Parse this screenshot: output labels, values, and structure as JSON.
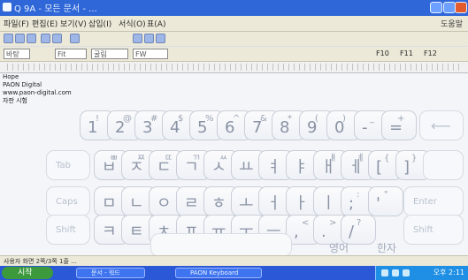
{
  "window": {
    "title": "Q 9A - 모든 문서 - ..."
  },
  "menubar": {
    "items": [
      "파일(F)",
      "편집(E)",
      "보기(V)",
      "삽입(I)",
      "서식(O)",
      "표(A)"
    ],
    "help": "도움말"
  },
  "formatbar": {
    "style_combo": "바탕",
    "size_combo": "Fit",
    "font_combo": "굴림",
    "zoom_combo": "FW",
    "function_keys": [
      "F10",
      "F11",
      "F12"
    ]
  },
  "document": {
    "lines": [
      "Hope",
      "PAON Digital",
      "www.paon-digital.com",
      "자판 시험"
    ]
  },
  "keyboard": {
    "row1": [
      {
        "primary": "1",
        "secondary": "!"
      },
      {
        "primary": "2",
        "secondary": "@"
      },
      {
        "primary": "3",
        "secondary": "#"
      },
      {
        "primary": "4",
        "secondary": "$"
      },
      {
        "primary": "5",
        "secondary": "%"
      },
      {
        "primary": "6",
        "secondary": "^"
      },
      {
        "primary": "7",
        "secondary": "&"
      },
      {
        "primary": "8",
        "secondary": "*"
      },
      {
        "primary": "9",
        "secondary": "("
      },
      {
        "primary": "0",
        "secondary": ")"
      },
      {
        "primary": "-",
        "secondary": "_"
      },
      {
        "primary": "=",
        "secondary": "+"
      }
    ],
    "row2": [
      {
        "primary": "ㅂ",
        "secondary": "ㅃ"
      },
      {
        "primary": "ㅈ",
        "secondary": "ㅉ"
      },
      {
        "primary": "ㄷ",
        "secondary": "ㄸ"
      },
      {
        "primary": "ㄱ",
        "secondary": "ㄲ"
      },
      {
        "primary": "ㅅ",
        "secondary": "ㅆ"
      },
      {
        "primary": "ㅛ",
        "secondary": ""
      },
      {
        "primary": "ㅕ",
        "secondary": ""
      },
      {
        "primary": "ㅑ",
        "secondary": ""
      },
      {
        "primary": "ㅐ",
        "secondary": "ㅒ"
      },
      {
        "primary": "ㅔ",
        "secondary": "ㅖ"
      },
      {
        "primary": "[",
        "secondary": "{"
      },
      {
        "primary": "]",
        "secondary": "}"
      }
    ],
    "row3": [
      {
        "primary": "ㅁ",
        "secondary": ""
      },
      {
        "primary": "ㄴ",
        "secondary": ""
      },
      {
        "primary": "ㅇ",
        "secondary": ""
      },
      {
        "primary": "ㄹ",
        "secondary": ""
      },
      {
        "primary": "ㅎ",
        "secondary": ""
      },
      {
        "primary": "ㅗ",
        "secondary": ""
      },
      {
        "primary": "ㅓ",
        "secondary": ""
      },
      {
        "primary": "ㅏ",
        "secondary": ""
      },
      {
        "primary": "ㅣ",
        "secondary": ""
      },
      {
        "primary": ";",
        "secondary": ":"
      },
      {
        "primary": "'",
        "secondary": "\""
      }
    ],
    "row4": [
      {
        "primary": "ㅋ",
        "secondary": ""
      },
      {
        "primary": "ㅌ",
        "secondary": ""
      },
      {
        "primary": "ㅊ",
        "secondary": ""
      },
      {
        "primary": "ㅍ",
        "secondary": ""
      },
      {
        "primary": "ㅠ",
        "secondary": ""
      },
      {
        "primary": "ㅜ",
        "secondary": ""
      },
      {
        "primary": "ㅡ",
        "secondary": ""
      },
      {
        "primary": ",",
        "secondary": "<"
      },
      {
        "primary": ".",
        "secondary": ">"
      },
      {
        "primary": "/",
        "secondary": "?"
      }
    ],
    "mods": {
      "backspace_glyph": "⟵",
      "tab": "Tab",
      "caps": "Caps",
      "shift_left": "Shift",
      "enter": "Enter",
      "shift_right": "Shift"
    },
    "bottom_right": {
      "left": "영어",
      "right": "한자"
    }
  },
  "statusbar": {
    "text": "사용자 화면 2쪽/3쪽 1줄 ..."
  },
  "taskbar": {
    "start_label": "시작",
    "tasks": [
      "문서 - 워드",
      "PAON Keyboard"
    ],
    "clock": "오후 2:11"
  }
}
